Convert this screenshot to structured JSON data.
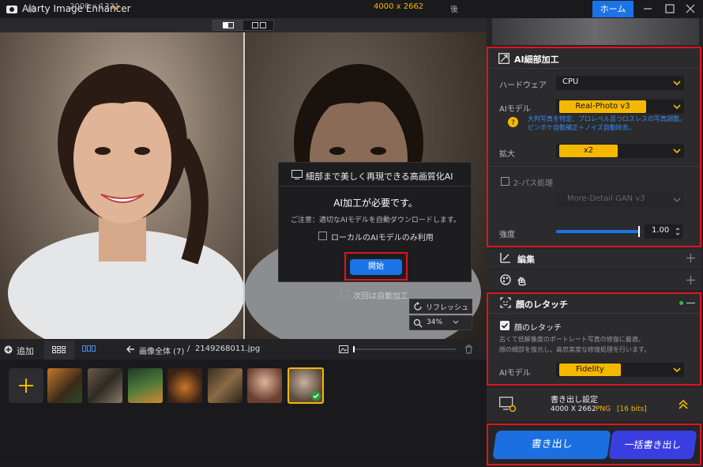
{
  "app": {
    "title": "Aiarty Image Enhancer",
    "home": "ホーム"
  },
  "toolbar": {
    "before": "前",
    "before_size": "2000 x 1331",
    "after_size": "4000 x 2662",
    "after": "後"
  },
  "dialog": {
    "title": "細部まで美しく再現できる高画質化AI",
    "heading": "AI加工が必要です。",
    "note": "ご注意：適切なAIモデルを自動ダウンロードします。",
    "local_only": "ローカルのAIモデルのみ利用",
    "start": "開始",
    "auto_next": "次回は自動加工"
  },
  "preview_ctrl": {
    "refresh": "リフレッシュ",
    "zoom": "34%"
  },
  "bottom": {
    "add": "追加",
    "breadcrumb_all": "画像全体 (7)",
    "separator": "/",
    "filename": "2149268011.jpg"
  },
  "right": {
    "ai_detail": {
      "title": "AI細部加工",
      "hardware_label": "ハードウェア",
      "hardware_value": "CPU",
      "model_label": "AIモデル",
      "model_value": "Real-Photo  v3",
      "model_desc": "大判写真を特定、プロレベル且つロスレスの写真調整。ピンボケ自動補正＋ノイズ自動除去。",
      "scale_label": "拡大",
      "scale_value": "x2",
      "twopass_label": "2-パス処理",
      "twopass_value": "More-Detail GAN  v3",
      "strength_label": "強度",
      "strength_value": "1.00",
      "strength_fraction": 0.97
    },
    "edit": {
      "title": "編集"
    },
    "color": {
      "title": "色"
    },
    "face": {
      "title": "顔のレタッチ",
      "check_label": "顔のレタッチ",
      "desc1": "古くて低解像度のポートレート写真の修復に最適。",
      "desc2": "顔の細部を復元し、高忠実度な修復処理を行います。",
      "model_label": "AIモデル",
      "model_value": "Fidelity"
    },
    "export_settings": {
      "title": "書き出し設定",
      "size": "4000 X 2662",
      "format": "PNG",
      "bits": "[16 bits]"
    },
    "export": "書き出し",
    "batch_export": "一括書き出し"
  },
  "colors": {
    "accent": "#1b73e8",
    "highlight": "#e0141e",
    "pill": "#f5b800"
  }
}
